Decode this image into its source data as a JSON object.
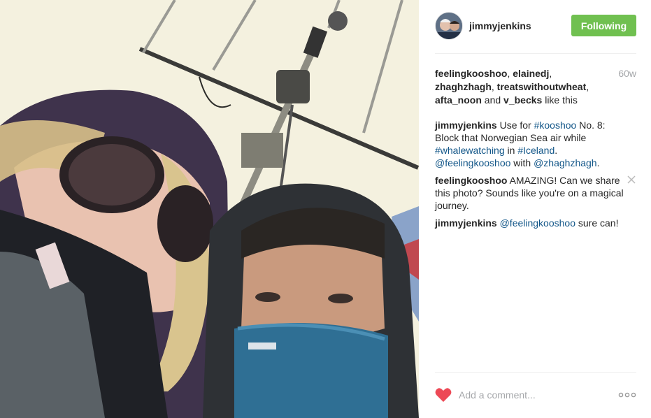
{
  "post": {
    "owner_username": "jimmyjenkins",
    "follow_button_label": "Following",
    "time_ago": "60w",
    "likes": {
      "users": [
        "feelingkooshoo",
        "elainedj",
        "zhaghzhagh",
        "treatswithoutwheat",
        "afta_noon",
        "v_becks"
      ],
      "and_text": " and ",
      "suffix": " like this",
      "separator": ", "
    },
    "comments": [
      {
        "author": "jimmyjenkins",
        "segments": [
          {
            "type": "text",
            "value": "Use for "
          },
          {
            "type": "link",
            "value": "#kooshoo"
          },
          {
            "type": "text",
            "value": " No. 8: Block that Norwegian Sea air while "
          },
          {
            "type": "link",
            "value": "#whalewatching"
          },
          {
            "type": "text",
            "value": " in "
          },
          {
            "type": "link",
            "value": "#Iceland"
          },
          {
            "type": "text",
            "value": ". "
          },
          {
            "type": "link",
            "value": "@feelingkooshoo"
          },
          {
            "type": "text",
            "value": " with "
          },
          {
            "type": "link",
            "value": "@zhaghzhagh"
          },
          {
            "type": "text",
            "value": "."
          }
        ],
        "deletable": false
      },
      {
        "author": "feelingkooshoo",
        "segments": [
          {
            "type": "text",
            "value": "AMAZING! Can we share this photo? Sounds like you're on a magical journey."
          }
        ],
        "deletable": true
      },
      {
        "author": "jimmyjenkins",
        "segments": [
          {
            "type": "link",
            "value": "@feelingkooshoo"
          },
          {
            "type": "text",
            "value": " sure can!"
          }
        ],
        "deletable": false
      }
    ],
    "add_comment_placeholder": "Add a comment...",
    "colors": {
      "follow_green": "#70c050",
      "link_blue": "#125688",
      "heart_red": "#ed4956",
      "muted_gray": "#a5a7aa"
    },
    "icons": [
      "heart-icon",
      "close-icon",
      "more-options-icon"
    ]
  }
}
